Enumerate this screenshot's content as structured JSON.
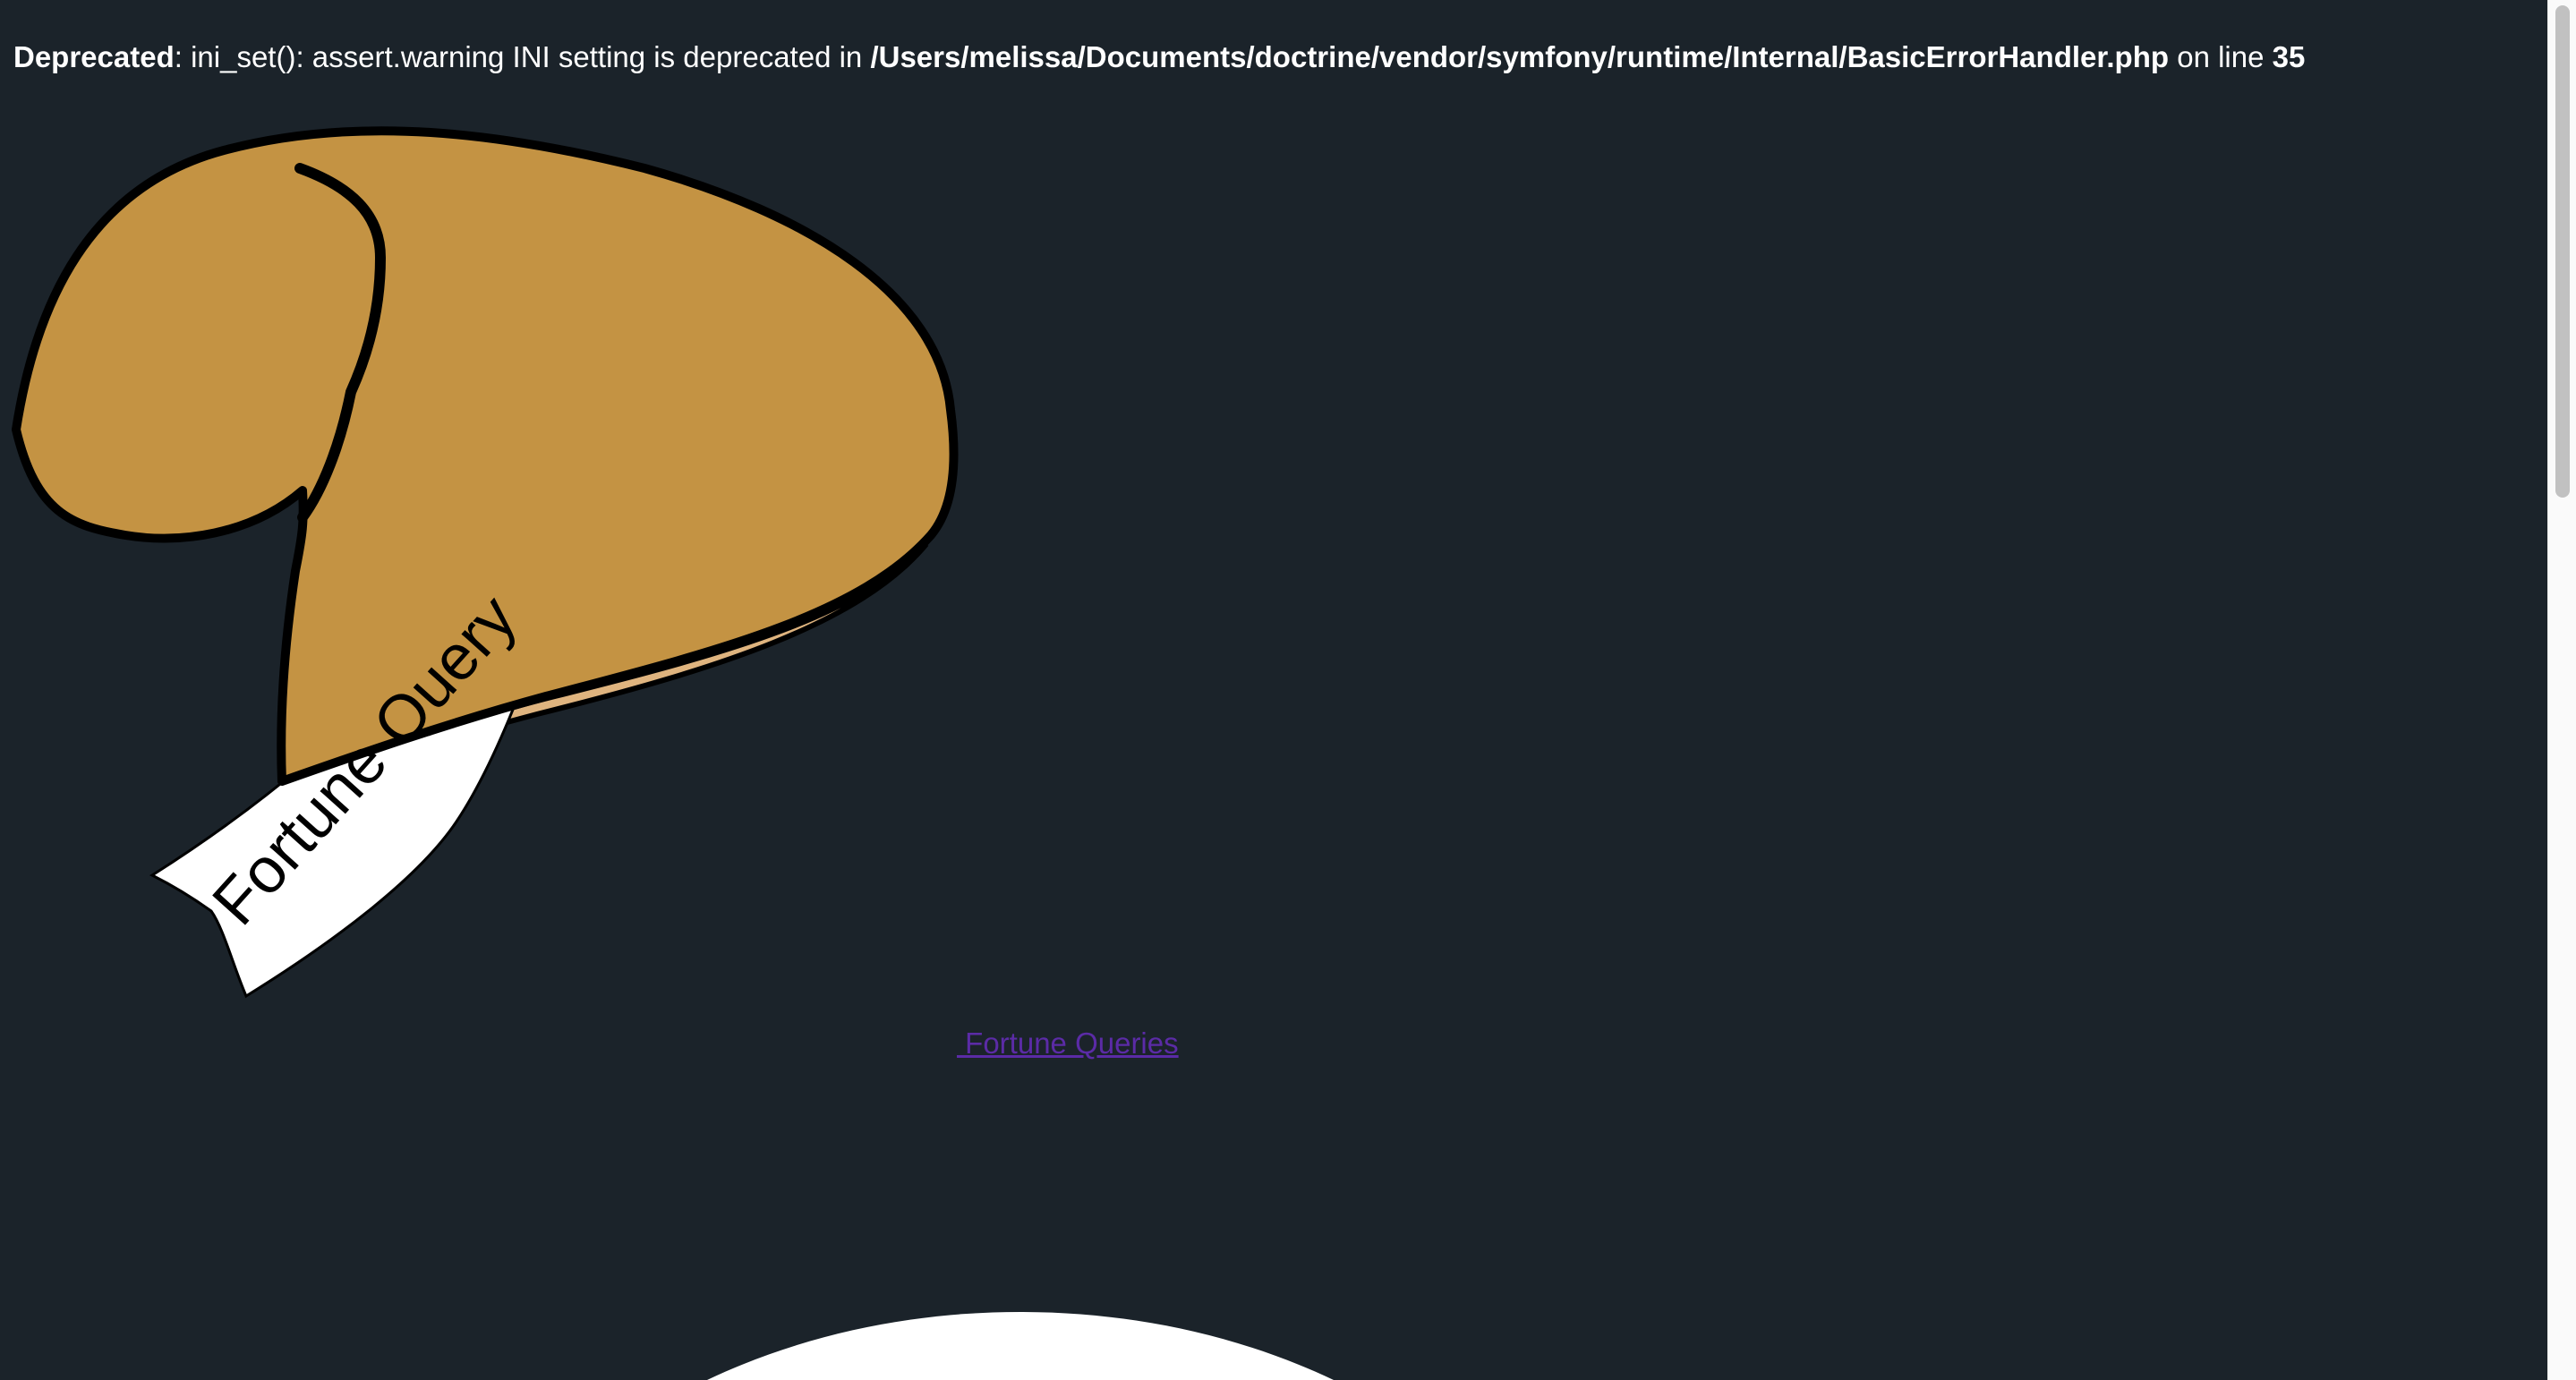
{
  "error": {
    "level": "Deprecated",
    "message": ": ini_set(): assert.warning INI setting is deprecated in ",
    "file": "/Users/melissa/Documents/doctrine/vendor/symfony/runtime/Internal/BasicErrorHandler.php",
    "line_prefix": " on line ",
    "line_number": "35"
  },
  "logo": {
    "ribbon_text": "Fortune Query",
    "icon": "fortune-cookie-icon",
    "colors": {
      "cookie": "#c49343",
      "cookie_inner": "#dfb47f",
      "outline": "#000000",
      "ribbon": "#ffffff"
    }
  },
  "nav": {
    "link_label": " Fortune Queries"
  },
  "colors": {
    "background": "#1b232a",
    "text": "#ffffff",
    "link": "#5b2ba6"
  }
}
